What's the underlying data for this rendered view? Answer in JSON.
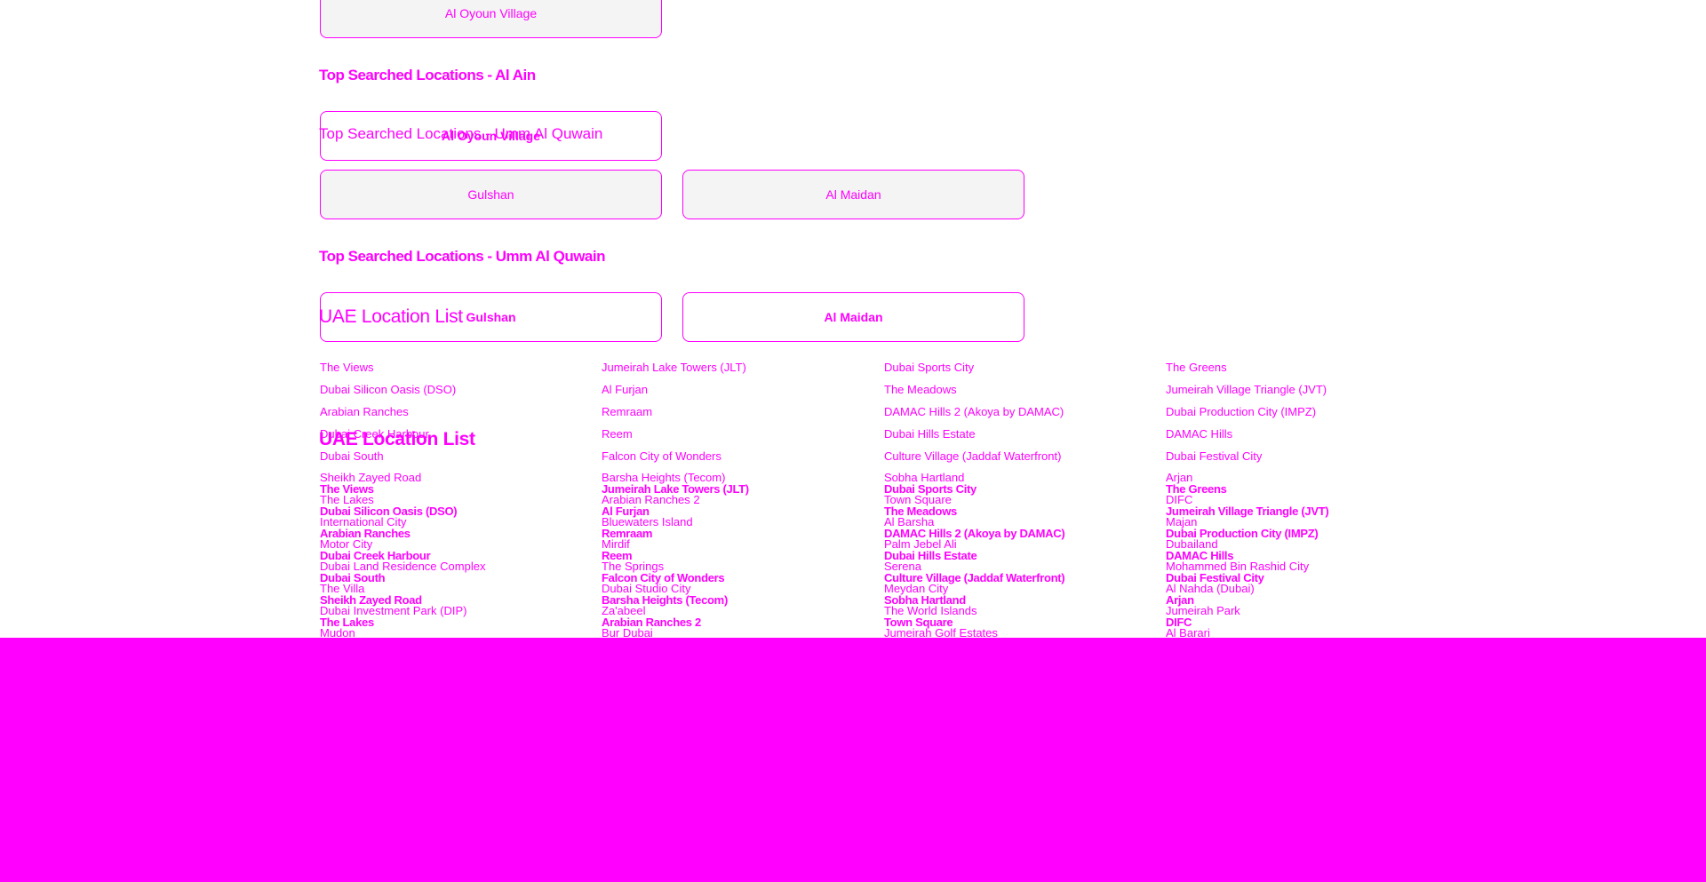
{
  "section_al_ain": {
    "top_button": "Al Oyoun Village",
    "heading": "Top Searched Locations - Al Ain"
  },
  "section_uaq": {
    "heading": "Top Searched Locations - Umm Al Quwain",
    "overlap_button": "Al Oyoun Village",
    "buttons": [
      "Gulshan",
      "Al Maidan"
    ],
    "heading_bold": "Top Searched Locations - Umm Al Quwain",
    "buttons_bold": [
      "Gulshan",
      "Al Maidan"
    ]
  },
  "uae_list": {
    "title": "UAE Location List",
    "title_bold": "UAE Location List",
    "col1_top": [
      "The Views",
      "Dubai Silicon Oasis (DSO)",
      "Arabian Ranches",
      "Dubai Creek Harbour",
      "Dubai South"
    ],
    "col2_top": [
      "Jumeirah Lake Towers (JLT)",
      "Al Furjan",
      "Remraam",
      "Reem",
      "Falcon City of Wonders"
    ],
    "col3_top": [
      "Dubai Sports City",
      "The Meadows",
      "DAMAC Hills 2 (Akoya by DAMAC)",
      "Dubai Hills Estate",
      "Culture Village (Jaddaf Waterfront)"
    ],
    "col4_top": [
      "The Greens",
      "Jumeirah Village Triangle (JVT)",
      "Dubai Production City (IMPZ)",
      "DAMAC Hills",
      "Dubai Festival City"
    ],
    "col1_tight": [
      "Sheikh Zayed Road",
      "The Views",
      "The Lakes",
      "Dubai Silicon Oasis (DSO)",
      "International City",
      "Arabian Ranches",
      "Motor City",
      "Dubai Creek Harbour",
      "Dubai Land Residence Complex",
      "Dubai South",
      "The Villa",
      "Sheikh Zayed Road",
      "Dubai Investment Park (DIP)",
      "The Lakes",
      "Mudon"
    ],
    "col1_bold_idx": [
      1,
      3,
      5,
      7,
      9,
      11,
      13
    ],
    "col2_tight": [
      "Barsha Heights (Tecom)",
      "Jumeirah Lake Towers (JLT)",
      "Arabian Ranches 2",
      "Al Furjan",
      "Bluewaters Island",
      "Remraam",
      "Mirdif",
      "Reem",
      "The Springs",
      "Falcon City of Wonders",
      "Dubai Studio City",
      "Barsha Heights (Tecom)",
      "Za'abeel",
      "Arabian Ranches 2",
      "Bur Dubai"
    ],
    "col3_tight": [
      "Sobha Hartland",
      "Dubai Sports City",
      "Town Square",
      "The Meadows",
      "Al Barsha",
      "DAMAC Hills 2 (Akoya by DAMAC)",
      "Palm Jebel Ali",
      "Dubai Hills Estate",
      "Serena",
      "Culture Village (Jaddaf Waterfront)",
      "Meydan City",
      "Sobha Hartland",
      "The World Islands",
      "Town Square",
      "Jumeirah Golf Estates"
    ],
    "col4_tight": [
      "Arjan",
      "The Greens",
      "DIFC",
      "Jumeirah Village Triangle (JVT)",
      "Majan",
      "Dubai Production City (IMPZ)",
      "Dubailand",
      "DAMAC Hills",
      "Mohammed Bin Rashid City",
      "Dubai Festival City",
      "Al Nahda (Dubai)",
      "Arjan",
      "Jumeirah Park",
      "DIFC",
      "Al Barari"
    ]
  },
  "colors": {
    "accent": "#ff00ff",
    "button_fill": "#f4f4f4",
    "background": "#ffffff"
  }
}
